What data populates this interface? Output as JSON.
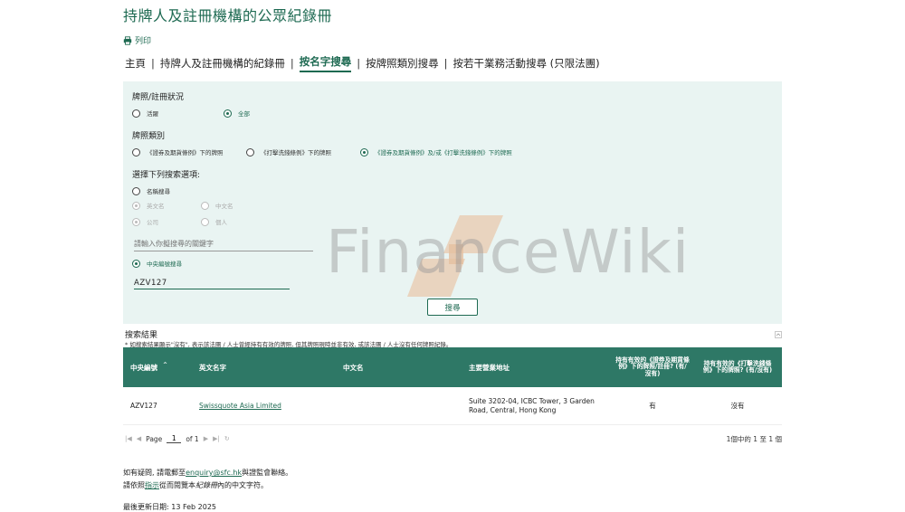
{
  "page": {
    "title": "持牌人及註冊機構的公眾紀錄冊",
    "print_label": "列印"
  },
  "nav": {
    "items": [
      {
        "label": "主頁"
      },
      {
        "label": "持牌人及註冊機構的紀錄冊"
      },
      {
        "label": "按名字搜尋"
      },
      {
        "label": "按牌照類別搜尋"
      },
      {
        "label": "按若干業務活動搜尋 (只限法團)"
      }
    ],
    "separator": "|"
  },
  "search": {
    "license_status_label": "牌照/註冊狀況",
    "status_options": [
      {
        "label": "活躍",
        "checked": false
      },
      {
        "label": "全部",
        "checked": true
      }
    ],
    "license_type_label": "牌照類別",
    "type_options": [
      {
        "label": "《證券及期貨條例》下的牌照",
        "checked": false
      },
      {
        "label": "《打擊洗錢條例》下的牌照",
        "checked": false
      },
      {
        "label": "《證券及期貨條例》及/或《打擊洗錢條例》下的牌照",
        "checked": true
      }
    ],
    "select_option_label": "選擇下列搜索選項:",
    "name_search_label": "名稱搜尋",
    "english_name_label": "英文名",
    "chinese_name_label": "中文名",
    "company_label": "公司",
    "individual_label": "個人",
    "keyword_placeholder": "請輸入你擬搜尋的關鍵字",
    "ce_search_label": "中央編號搜尋",
    "ce_value": "AZV127",
    "search_button": "搜尋"
  },
  "results": {
    "title": "搜索結果",
    "note": "* 如搜索結果顯示\"沒有\", 表示該法團 / 人士曾經持有有效的牌照, 但其牌照現時並非有效, 或該法團 / 人士沒有任何牌照紀錄。",
    "columns": [
      {
        "label": "中央編號",
        "sort": "^"
      },
      {
        "label": "英文名字"
      },
      {
        "label": "中文名"
      },
      {
        "label": "主要營業地址"
      },
      {
        "label": "持有有效的《證券及期貨條例》下的牌照/註冊? (有/沒有)"
      },
      {
        "label": "持有有效的《打擊洗錢條例》下的牌照? (有/沒有)"
      }
    ],
    "rows": [
      {
        "ce_no": "AZV127",
        "english_name": "Swissquote Asia Limited",
        "chinese_name": "",
        "address": "Suite 3202-04, ICBC Tower, 3 Garden Road, Central, Hong Kong",
        "sfo_license": "有",
        "amlo_license": "沒有"
      }
    ]
  },
  "pager": {
    "page_label": "Page",
    "current_page": "1",
    "of_label": "of 1",
    "summary": "1個中的 1 至 1 個"
  },
  "footer": {
    "enquiry_prefix": "如有疑問, 請電郵至",
    "enquiry_email": "enquiry@sfc.hk",
    "enquiry_suffix": "與證監會聯絡。",
    "guide_prefix": "請依照",
    "guide_link": "指示",
    "guide_middle": "從而閱覽本",
    "guide_italic": "紀錄冊",
    "guide_suffix": "內的中文字符。",
    "last_updated": "最後更新日期: 13 Feb 2025"
  },
  "watermark": {
    "text": "FinanceWiki"
  },
  "colors": {
    "brand_green": "#1e6a52",
    "table_header": "#2e7866",
    "panel_bg": "#e9f4f2"
  }
}
